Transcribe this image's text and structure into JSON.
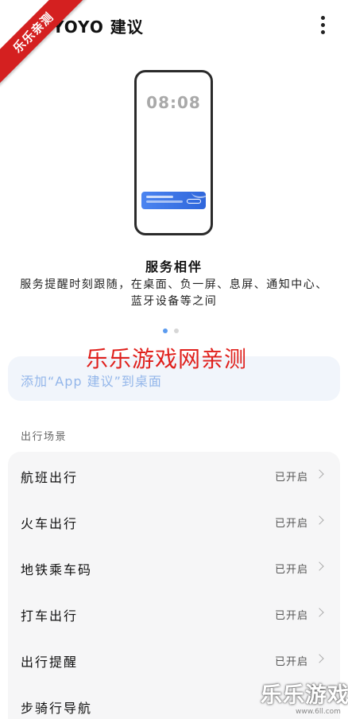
{
  "header": {
    "title": "YOYO 建议",
    "more_icon": "more-vertical-icon"
  },
  "ribbon": {
    "text": "乐乐亲测",
    "color": "#d42020"
  },
  "illustration": {
    "clock_time": "08:08",
    "card_color": "#3a73e2"
  },
  "feature": {
    "title": "服务相伴",
    "description": "服务提醒时刻跟随，在桌面、负一屏、息屏、通知中心、蓝牙设备等之间"
  },
  "carousel": {
    "page_count": 2,
    "active_index": 0,
    "active_color": "#5b9bef"
  },
  "add_card": {
    "label": "添加“App 建议”到桌面"
  },
  "watermarks": {
    "center": "乐乐游戏网亲测",
    "corner": "乐乐游戏",
    "url": "www.6ll.com"
  },
  "travel": {
    "section_title": "出行场景",
    "items": [
      {
        "label": "航班出行",
        "status": "已开启"
      },
      {
        "label": "火车出行",
        "status": "已开启"
      },
      {
        "label": "地铁乘车码",
        "status": "已开启"
      },
      {
        "label": "打车出行",
        "status": "已开启"
      },
      {
        "label": "出行提醒",
        "status": "已开启"
      },
      {
        "label": "步骑行导航",
        "status": ""
      }
    ]
  }
}
